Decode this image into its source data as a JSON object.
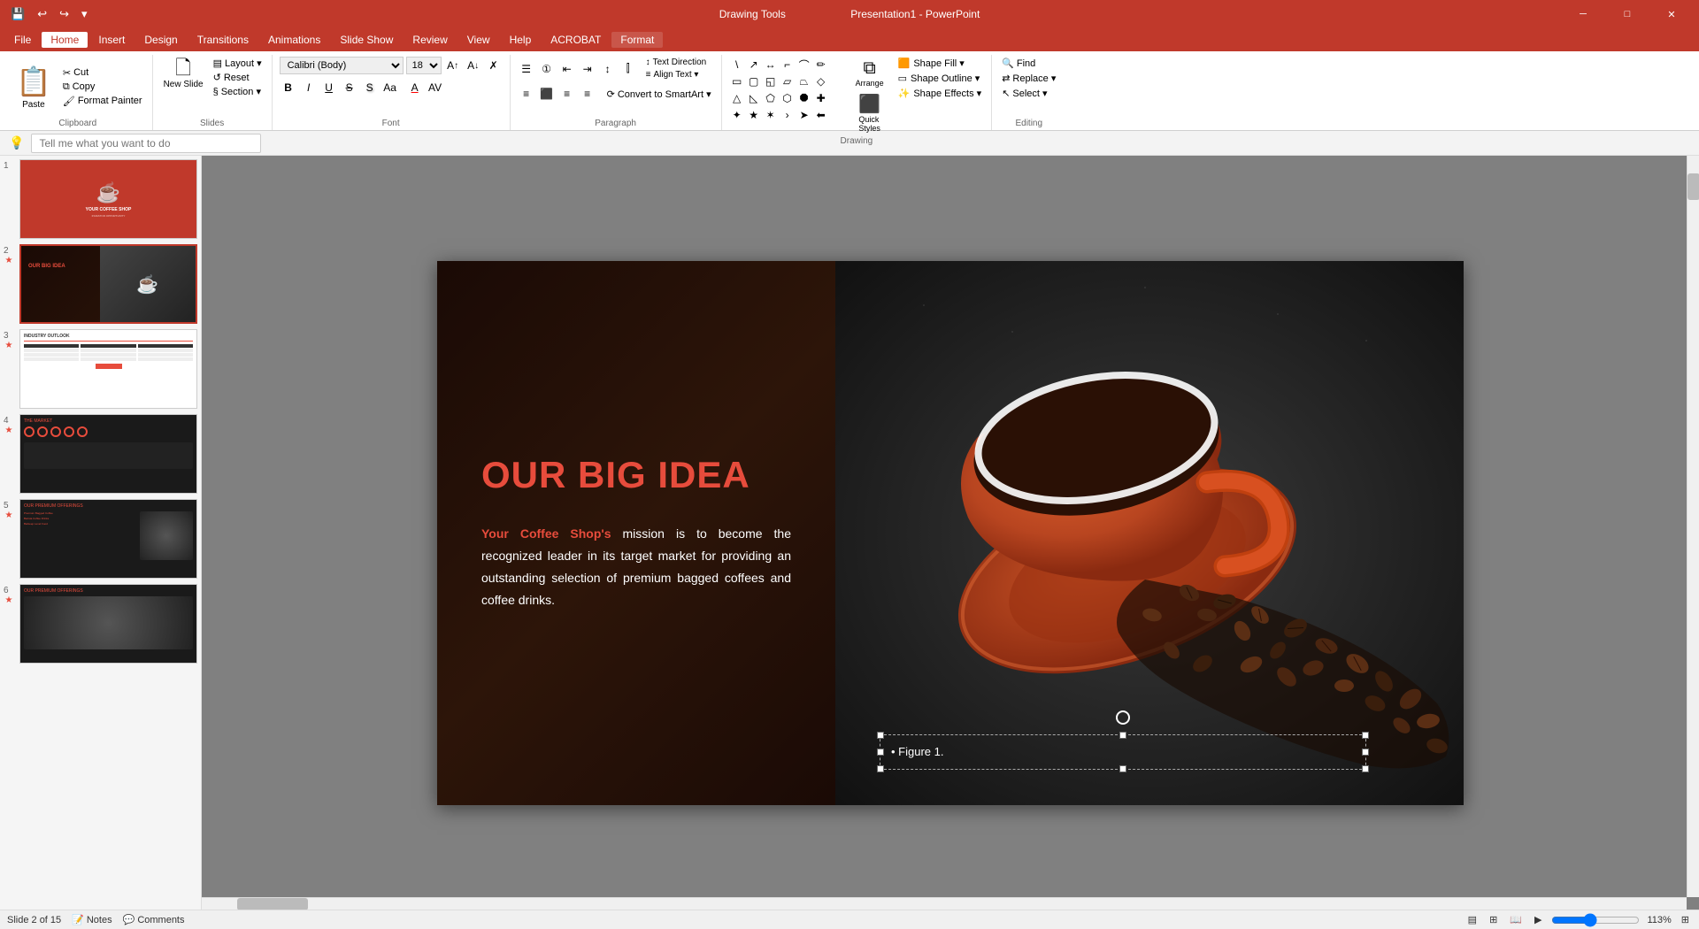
{
  "titlebar": {
    "app_name": "Drawing Tools",
    "file_name": "Presentation1 - PowerPoint",
    "minimize": "─",
    "restore": "□",
    "close": "✕"
  },
  "quickaccess": {
    "save": "💾",
    "undo": "↩",
    "redo": "↪",
    "customize": "▾"
  },
  "menu": {
    "items": [
      "File",
      "Home",
      "Insert",
      "Design",
      "Transitions",
      "Animations",
      "Slide Show",
      "Review",
      "View",
      "Help",
      "ACROBAT",
      "Format"
    ]
  },
  "ribbon": {
    "groups": {
      "clipboard": {
        "label": "Clipboard",
        "paste_label": "Paste",
        "cut_label": "Cut",
        "copy_label": "Copy",
        "format_painter_label": "Format Painter"
      },
      "slides": {
        "label": "Slides",
        "new_slide": "New Slide",
        "layout": "Layout ▾",
        "reset": "Reset",
        "section": "Section ▾"
      },
      "font": {
        "label": "Font",
        "font_name": "Calibri (Body)",
        "font_size": "18",
        "bold": "B",
        "italic": "I",
        "underline": "U",
        "strikethrough": "S",
        "shadow": "S",
        "font_color": "A",
        "increase_size": "A↑",
        "decrease_size": "A↓",
        "clear_format": "✗",
        "change_case": "Aa",
        "char_spacing": "A⟷"
      },
      "paragraph": {
        "label": "Paragraph",
        "bullets": "☰",
        "numbering": "1.",
        "decrease_indent": "◁",
        "increase_indent": "▷",
        "left_align": "≡",
        "center_align": "≡",
        "right_align": "≡",
        "justify": "≡",
        "columns": "⊞",
        "line_spacing": "↕",
        "text_direction": "Text Direction",
        "align_text": "Align Text ▾",
        "convert_smartart": "Convert to SmartArt ▾"
      },
      "drawing": {
        "label": "Drawing",
        "shapes": "Shapes",
        "arrange": "Arrange",
        "quick_styles": "Quick Styles",
        "shape_fill": "Shape Fill ▾",
        "shape_outline": "Shape Outline ▾",
        "shape_effects": "Shape Effects ▾"
      },
      "editing": {
        "label": "Editing",
        "find": "Find",
        "replace": "Replace ▾",
        "select": "Select ▾"
      }
    },
    "search_placeholder": "Tell me what you want to do"
  },
  "slides": [
    {
      "num": "1",
      "type": "title",
      "bg": "red",
      "active": false,
      "has_star": false
    },
    {
      "num": "2",
      "type": "big_idea",
      "bg": "dark",
      "active": true,
      "has_star": true
    },
    {
      "num": "3",
      "type": "industry",
      "bg": "white",
      "active": false,
      "has_star": true
    },
    {
      "num": "4",
      "type": "market",
      "bg": "dark",
      "active": false,
      "has_star": true
    },
    {
      "num": "5",
      "type": "offerings",
      "bg": "dark",
      "active": false,
      "has_star": true
    },
    {
      "num": "6",
      "type": "offerings2",
      "bg": "dark",
      "active": false,
      "has_star": true
    }
  ],
  "main_slide": {
    "title": "OUR BIG IDEA",
    "highlight_text": "Your Coffee Shop's",
    "body_text": " mission is to become the recognized leader in its target market for providing an outstanding selection of premium bagged coffees and coffee drinks.",
    "figure_caption": "• Figure 1."
  },
  "statusbar": {
    "slide_info": "Slide 2 of 15",
    "notes_btn": "Notes",
    "comments_btn": "Comments",
    "zoom_level": "113%",
    "fit_btn": "⊞"
  }
}
